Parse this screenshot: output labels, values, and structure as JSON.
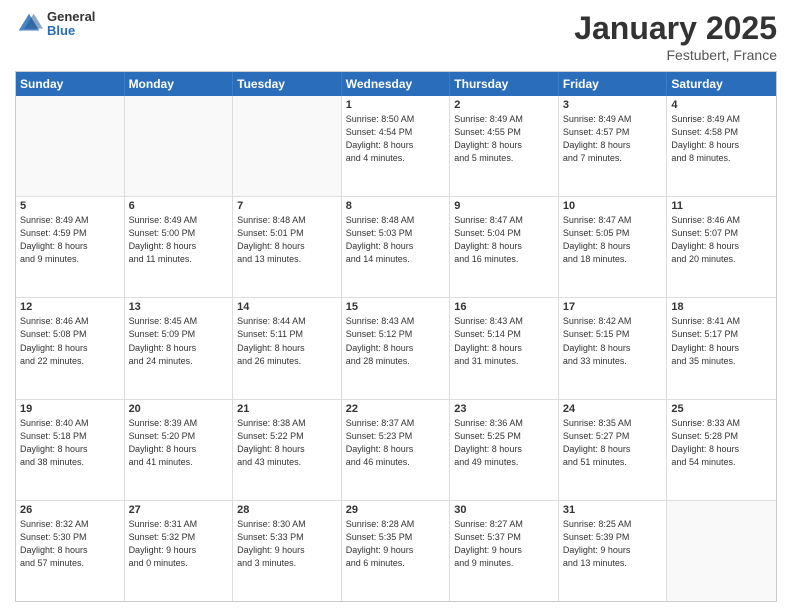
{
  "header": {
    "logo_general": "General",
    "logo_blue": "Blue",
    "month_title": "January 2025",
    "location": "Festubert, France"
  },
  "weekdays": [
    "Sunday",
    "Monday",
    "Tuesday",
    "Wednesday",
    "Thursday",
    "Friday",
    "Saturday"
  ],
  "rows": [
    [
      {
        "day": "",
        "info": ""
      },
      {
        "day": "",
        "info": ""
      },
      {
        "day": "",
        "info": ""
      },
      {
        "day": "1",
        "info": "Sunrise: 8:50 AM\nSunset: 4:54 PM\nDaylight: 8 hours\nand 4 minutes."
      },
      {
        "day": "2",
        "info": "Sunrise: 8:49 AM\nSunset: 4:55 PM\nDaylight: 8 hours\nand 5 minutes."
      },
      {
        "day": "3",
        "info": "Sunrise: 8:49 AM\nSunset: 4:57 PM\nDaylight: 8 hours\nand 7 minutes."
      },
      {
        "day": "4",
        "info": "Sunrise: 8:49 AM\nSunset: 4:58 PM\nDaylight: 8 hours\nand 8 minutes."
      }
    ],
    [
      {
        "day": "5",
        "info": "Sunrise: 8:49 AM\nSunset: 4:59 PM\nDaylight: 8 hours\nand 9 minutes."
      },
      {
        "day": "6",
        "info": "Sunrise: 8:49 AM\nSunset: 5:00 PM\nDaylight: 8 hours\nand 11 minutes."
      },
      {
        "day": "7",
        "info": "Sunrise: 8:48 AM\nSunset: 5:01 PM\nDaylight: 8 hours\nand 13 minutes."
      },
      {
        "day": "8",
        "info": "Sunrise: 8:48 AM\nSunset: 5:03 PM\nDaylight: 8 hours\nand 14 minutes."
      },
      {
        "day": "9",
        "info": "Sunrise: 8:47 AM\nSunset: 5:04 PM\nDaylight: 8 hours\nand 16 minutes."
      },
      {
        "day": "10",
        "info": "Sunrise: 8:47 AM\nSunset: 5:05 PM\nDaylight: 8 hours\nand 18 minutes."
      },
      {
        "day": "11",
        "info": "Sunrise: 8:46 AM\nSunset: 5:07 PM\nDaylight: 8 hours\nand 20 minutes."
      }
    ],
    [
      {
        "day": "12",
        "info": "Sunrise: 8:46 AM\nSunset: 5:08 PM\nDaylight: 8 hours\nand 22 minutes."
      },
      {
        "day": "13",
        "info": "Sunrise: 8:45 AM\nSunset: 5:09 PM\nDaylight: 8 hours\nand 24 minutes."
      },
      {
        "day": "14",
        "info": "Sunrise: 8:44 AM\nSunset: 5:11 PM\nDaylight: 8 hours\nand 26 minutes."
      },
      {
        "day": "15",
        "info": "Sunrise: 8:43 AM\nSunset: 5:12 PM\nDaylight: 8 hours\nand 28 minutes."
      },
      {
        "day": "16",
        "info": "Sunrise: 8:43 AM\nSunset: 5:14 PM\nDaylight: 8 hours\nand 31 minutes."
      },
      {
        "day": "17",
        "info": "Sunrise: 8:42 AM\nSunset: 5:15 PM\nDaylight: 8 hours\nand 33 minutes."
      },
      {
        "day": "18",
        "info": "Sunrise: 8:41 AM\nSunset: 5:17 PM\nDaylight: 8 hours\nand 35 minutes."
      }
    ],
    [
      {
        "day": "19",
        "info": "Sunrise: 8:40 AM\nSunset: 5:18 PM\nDaylight: 8 hours\nand 38 minutes."
      },
      {
        "day": "20",
        "info": "Sunrise: 8:39 AM\nSunset: 5:20 PM\nDaylight: 8 hours\nand 41 minutes."
      },
      {
        "day": "21",
        "info": "Sunrise: 8:38 AM\nSunset: 5:22 PM\nDaylight: 8 hours\nand 43 minutes."
      },
      {
        "day": "22",
        "info": "Sunrise: 8:37 AM\nSunset: 5:23 PM\nDaylight: 8 hours\nand 46 minutes."
      },
      {
        "day": "23",
        "info": "Sunrise: 8:36 AM\nSunset: 5:25 PM\nDaylight: 8 hours\nand 49 minutes."
      },
      {
        "day": "24",
        "info": "Sunrise: 8:35 AM\nSunset: 5:27 PM\nDaylight: 8 hours\nand 51 minutes."
      },
      {
        "day": "25",
        "info": "Sunrise: 8:33 AM\nSunset: 5:28 PM\nDaylight: 8 hours\nand 54 minutes."
      }
    ],
    [
      {
        "day": "26",
        "info": "Sunrise: 8:32 AM\nSunset: 5:30 PM\nDaylight: 8 hours\nand 57 minutes."
      },
      {
        "day": "27",
        "info": "Sunrise: 8:31 AM\nSunset: 5:32 PM\nDaylight: 9 hours\nand 0 minutes."
      },
      {
        "day": "28",
        "info": "Sunrise: 8:30 AM\nSunset: 5:33 PM\nDaylight: 9 hours\nand 3 minutes."
      },
      {
        "day": "29",
        "info": "Sunrise: 8:28 AM\nSunset: 5:35 PM\nDaylight: 9 hours\nand 6 minutes."
      },
      {
        "day": "30",
        "info": "Sunrise: 8:27 AM\nSunset: 5:37 PM\nDaylight: 9 hours\nand 9 minutes."
      },
      {
        "day": "31",
        "info": "Sunrise: 8:25 AM\nSunset: 5:39 PM\nDaylight: 9 hours\nand 13 minutes."
      },
      {
        "day": "",
        "info": ""
      }
    ]
  ]
}
